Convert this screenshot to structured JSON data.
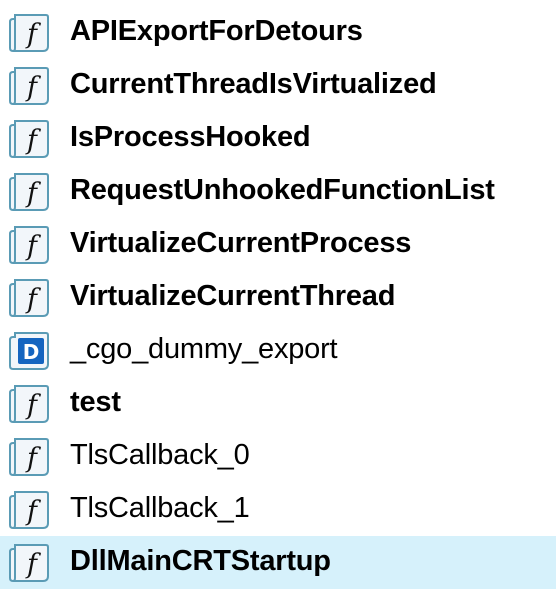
{
  "functions": [
    {
      "name": "APIExportForDetours",
      "icon": "function-icon",
      "bold": true,
      "selected": false
    },
    {
      "name": "CurrentThreadIsVirtualized",
      "icon": "function-icon",
      "bold": true,
      "selected": false
    },
    {
      "name": "IsProcessHooked",
      "icon": "function-icon",
      "bold": true,
      "selected": false
    },
    {
      "name": "RequestUnhookedFunctionList",
      "icon": "function-icon",
      "bold": true,
      "selected": false
    },
    {
      "name": "VirtualizeCurrentProcess",
      "icon": "function-icon",
      "bold": true,
      "selected": false
    },
    {
      "name": "VirtualizeCurrentThread",
      "icon": "function-icon",
      "bold": true,
      "selected": false
    },
    {
      "name": "_cgo_dummy_export",
      "icon": "data-icon",
      "bold": false,
      "selected": false
    },
    {
      "name": "test",
      "icon": "function-icon",
      "bold": true,
      "selected": false
    },
    {
      "name": "TlsCallback_0",
      "icon": "function-icon",
      "bold": false,
      "selected": false
    },
    {
      "name": "TlsCallback_1",
      "icon": "function-icon",
      "bold": false,
      "selected": false
    },
    {
      "name": "DllMainCRTStartup",
      "icon": "function-icon",
      "bold": true,
      "selected": true
    }
  ],
  "colors": {
    "icon_border": "#5a9bb5",
    "icon_fill": "#f2f6fa",
    "data_icon_fill": "#1565c0",
    "selected_row": "#d6f1fb",
    "text": "#000000"
  },
  "icon_glyphs": {
    "function-icon": "f",
    "data-icon": "D"
  }
}
